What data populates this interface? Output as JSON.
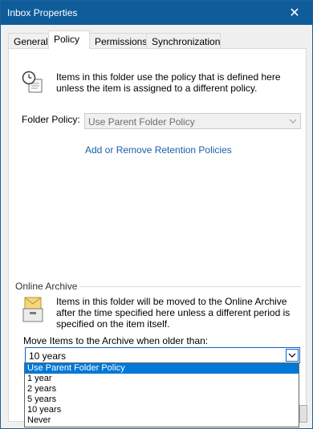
{
  "window": {
    "title": "Inbox Properties",
    "close_glyph": "✕"
  },
  "tabs": [
    {
      "label": "General",
      "active": false
    },
    {
      "label": "Policy",
      "active": true
    },
    {
      "label": "Permissions",
      "active": false
    },
    {
      "label": "Synchronization",
      "active": false
    }
  ],
  "policy": {
    "info_text": "Items in this folder use the policy that is defined here unless the item is assigned to a different policy.",
    "folder_policy_label": "Folder Policy:",
    "folder_policy_value": "Use Parent Folder Policy",
    "link_text": "Add or Remove Retention Policies"
  },
  "archive": {
    "section_label": "Online Archive",
    "info_text": "Items in this folder will be moved to the Online Archive after the time specified here unless a different period is specified on the item itself.",
    "move_label": "Move Items to the Archive when older than:",
    "selected_value": "10 years",
    "options": [
      "Use Parent Folder Policy",
      "1 year",
      "2 years",
      "5 years",
      "10 years",
      "Never"
    ],
    "highlighted_option": "Use Parent Folder Policy"
  },
  "icons": {
    "policy_icon": "clock-document-icon",
    "archive_icon": "archive-envelope-icon",
    "dropdown_arrow": "chevron-down-icon"
  },
  "colors": {
    "titlebar": "#0f5c9a",
    "link": "#1a5fa8",
    "selection": "#0078d7",
    "focus_border": "#0a64c8"
  }
}
